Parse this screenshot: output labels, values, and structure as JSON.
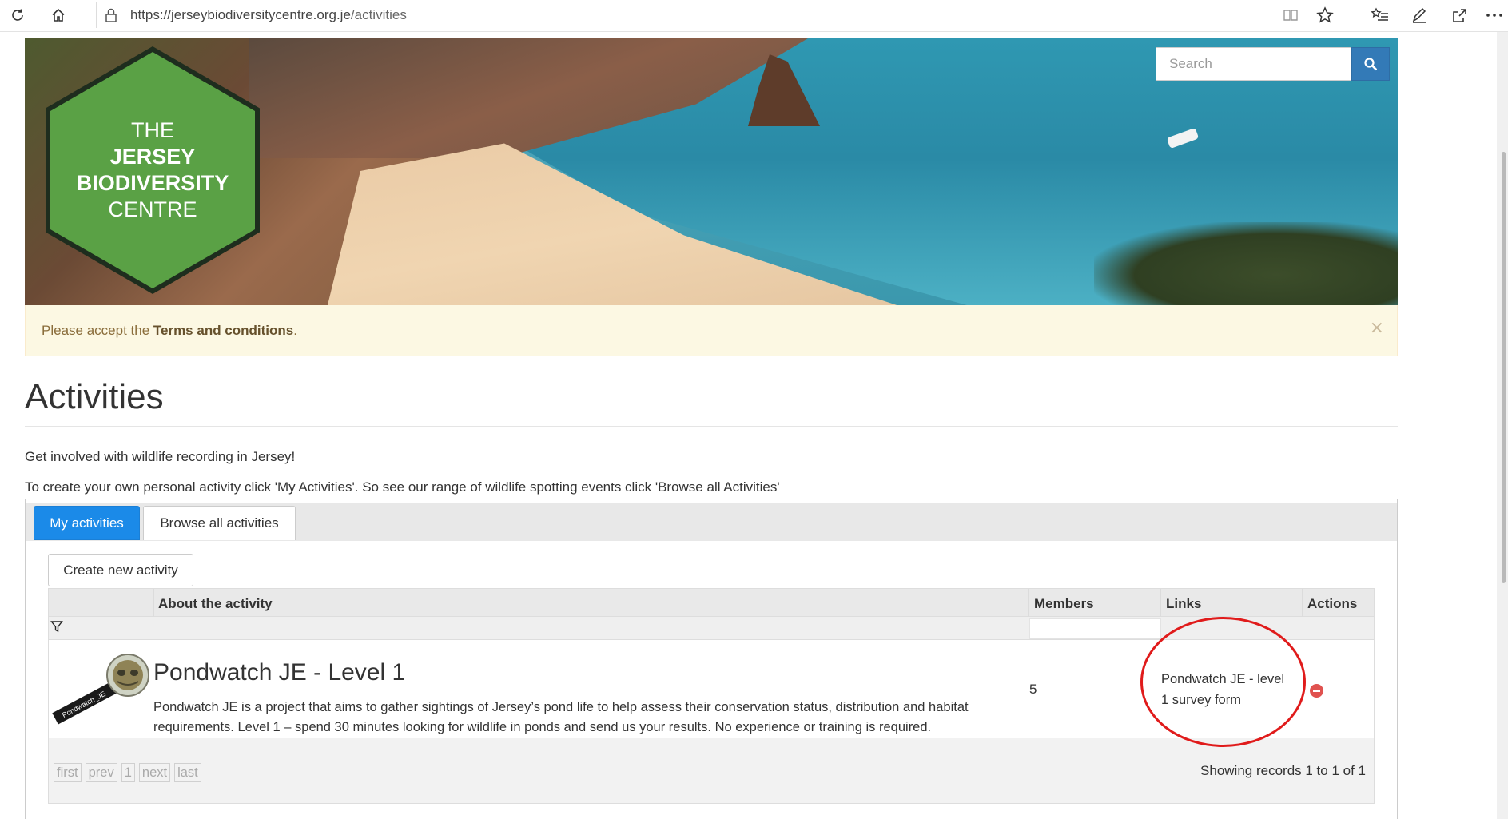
{
  "browser": {
    "url_domain": "https://jerseybiodiversitycentre.org.je",
    "url_path": "/activities"
  },
  "logo": {
    "line1": "THE",
    "line2": "JERSEY",
    "line3": "BIODIVERSITY",
    "line4": "CENTRE"
  },
  "search": {
    "placeholder": "Search"
  },
  "alert": {
    "prefix": "Please accept the ",
    "link": "Terms and conditions",
    "suffix": ".",
    "close": "×"
  },
  "page": {
    "title": "Activities",
    "intro1": "Get involved with wildlife recording in Jersey!",
    "intro2": "To create your own personal activity click 'My Activities'. So see our range of wildlife spotting events click 'Browse all Activities'"
  },
  "tabs": [
    {
      "label": "My activities",
      "active": true
    },
    {
      "label": "Browse all activities",
      "active": false
    }
  ],
  "create_button": "Create new activity",
  "grid": {
    "columns": [
      "About the activity",
      "Members",
      "Links",
      "Actions"
    ],
    "rows": [
      {
        "title": "Pondwatch JE - Level 1",
        "description": "Pondwatch JE is a project that aims to gather sightings of Jersey’s pond life to help assess their conservation status, distribution and habitat requirements. Level 1 – spend 30 minutes looking for wildlife in ponds and send us your results. No experience or training is required.",
        "members": "5",
        "link_line1": "Pondwatch JE - level",
        "link_line2": "1 survey form",
        "avatar_label": "Pondwatch_JE"
      }
    ],
    "pager": [
      "first",
      "prev",
      "1",
      "next",
      "last"
    ],
    "showing": "Showing records 1 to 1 of 1"
  },
  "colors": {
    "accent": "#1b8ae8",
    "logo_green": "#5aa145",
    "alert_bg": "#fcf8e3",
    "annotation": "#e01b1b"
  }
}
